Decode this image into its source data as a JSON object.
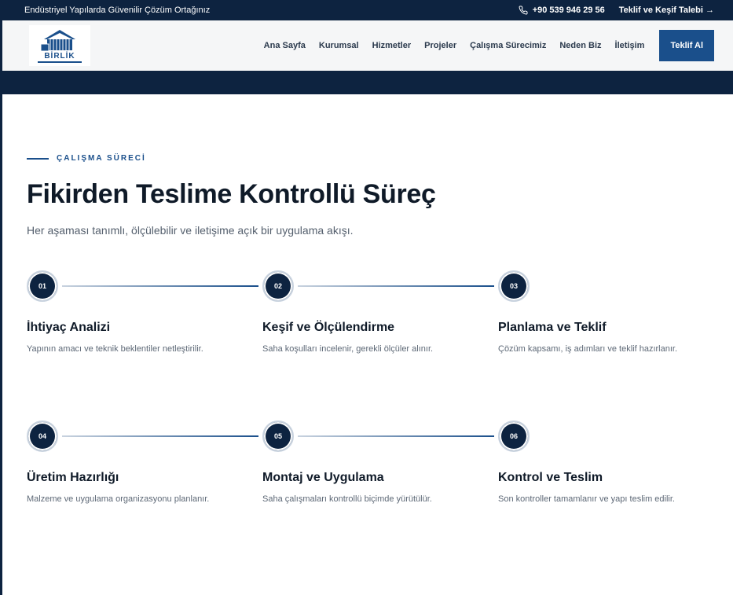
{
  "topbar": {
    "tagline": "Endüstriyel Yapılarda Güvenilir Çözüm Ortağınız",
    "phone": "+90 539 946 29 56",
    "cta_link": "Teklif ve Keşif Talebi →"
  },
  "logo": {
    "text": "BİRLİK"
  },
  "nav": {
    "items": [
      "Ana Sayfa",
      "Kurumsal",
      "Hizmetler",
      "Projeler",
      "Çalışma Sürecimiz",
      "Neden Biz",
      "İletişim"
    ],
    "cta": "Teklif Al"
  },
  "section": {
    "eyebrow": "ÇALIŞMA SÜRECİ",
    "title": "Fikirden Teslime Kontrollü Süreç",
    "subtitle": "Her aşaması tanımlı, ölçülebilir ve iletişime açık bir uygulama akışı."
  },
  "steps": [
    {
      "num": "01",
      "title": "İhtiyaç Analizi",
      "desc": "Yapının amacı ve teknik beklentiler netleştirilir."
    },
    {
      "num": "02",
      "title": "Keşif ve Ölçülendirme",
      "desc": "Saha koşulları incelenir, gerekli ölçüler alınır."
    },
    {
      "num": "03",
      "title": "Planlama ve Teklif",
      "desc": "Çözüm kapsamı, iş adımları ve teklif hazırlanır."
    },
    {
      "num": "04",
      "title": "Üretim Hazırlığı",
      "desc": "Malzeme ve uygulama organizasyonu planlanır."
    },
    {
      "num": "05",
      "title": "Montaj ve Uygulama",
      "desc": "Saha çalışmaları kontrollü biçimde yürütülür."
    },
    {
      "num": "06",
      "title": "Kontrol ve Teslim",
      "desc": "Son kontroller tamamlanır ve yapı teslim edilir."
    }
  ],
  "colors": {
    "navy": "#0d2340",
    "accent": "#1a4f8b",
    "text": "#0f1a28",
    "muted": "#5d6876"
  }
}
